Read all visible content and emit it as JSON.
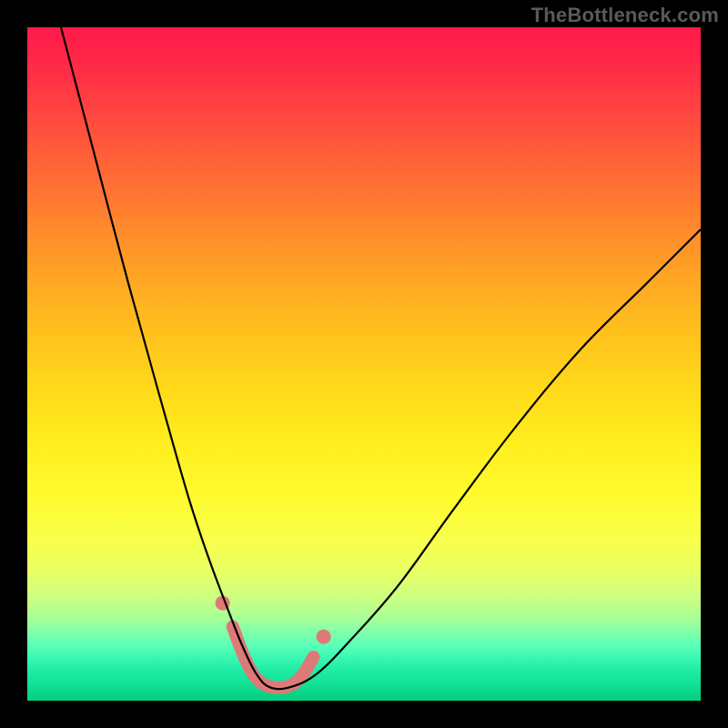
{
  "watermark": "TheBottleneck.com",
  "colors": {
    "frame_bg": "#000000",
    "curve": "#000000",
    "marker": "#dd7a78"
  },
  "chart_data": {
    "type": "line",
    "title": "",
    "xlabel": "",
    "ylabel": "",
    "xlim": [
      0,
      100
    ],
    "ylim": [
      0,
      100
    ],
    "gradient_scale_note": "background vertical gradient maps y from 100 (top, worst) to 0 (bottom, best); red=high bottleneck, green=low",
    "series": [
      {
        "name": "bottleneck-curve",
        "x": [
          5,
          10,
          15,
          20,
          24,
          27,
          30,
          32,
          34,
          36,
          39,
          43,
          48,
          55,
          63,
          72,
          82,
          92,
          100
        ],
        "y": [
          100,
          81,
          62,
          44,
          30,
          21,
          13,
          8,
          4,
          2,
          2,
          4,
          9,
          17,
          28,
          40,
          52,
          62,
          70
        ]
      }
    ],
    "markers": {
      "name": "optimal-range",
      "x": [
        30.5,
        32,
        33.5,
        35,
        36.5,
        38,
        39.5,
        41,
        42.5
      ],
      "y": [
        11,
        7,
        4,
        2.5,
        2,
        2,
        2.5,
        4,
        6.5
      ],
      "endpoint_dots": {
        "left": {
          "x": 29.0,
          "y": 14.5
        },
        "right": {
          "x": 44.0,
          "y": 9.5
        }
      }
    }
  }
}
